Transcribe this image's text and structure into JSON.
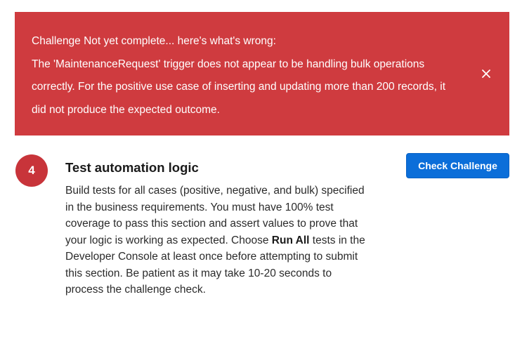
{
  "error_banner": {
    "lines": [
      "Challenge Not yet complete... here's what's wrong:",
      "The 'MaintenanceRequest' trigger does not appear to be handling bulk operations",
      "correctly. For the positive use case of inserting and updating more than 200 records, it",
      "did not produce the expected outcome."
    ],
    "close_icon": "close-icon",
    "background_color": "#cf3b3f"
  },
  "step": {
    "number": "4",
    "title": "Test automation logic",
    "check_button_label": "Check Challenge",
    "description": {
      "line1": "Build tests for all cases (positive, negative, and bulk) specified",
      "line2": "in the business requirements. You must have 100% test",
      "line3": "coverage to pass this section and assert values to prove that",
      "line4_before": "your logic is working as expected. Choose ",
      "line4_bold": "Run All",
      "line4_after": " tests in the",
      "line5": "Developer Console at least once before attempting to submit",
      "line6": "this section. Be patient as it may take 10-20 seconds to",
      "line7": "process the challenge check."
    },
    "circle_color": "#c8343a",
    "button_color": "#0b6ed9"
  }
}
